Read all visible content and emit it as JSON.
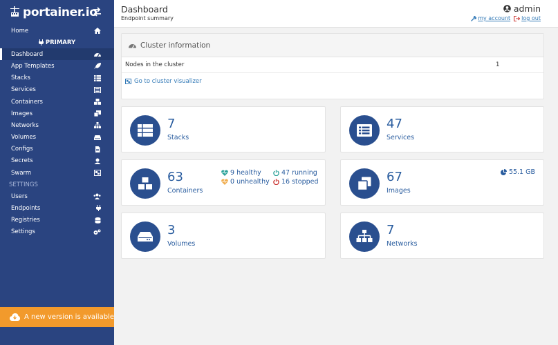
{
  "brand": {
    "name": "portainer.io"
  },
  "sidebar": {
    "home": "Home",
    "endpoint": "PRIMARY",
    "items": [
      {
        "label": "Dashboard",
        "icon": "tachometer-icon",
        "active": true
      },
      {
        "label": "App Templates",
        "icon": "rocket-icon"
      },
      {
        "label": "Stacks",
        "icon": "th-list-icon"
      },
      {
        "label": "Services",
        "icon": "list-alt-icon"
      },
      {
        "label": "Containers",
        "icon": "server-icon"
      },
      {
        "label": "Images",
        "icon": "clone-icon"
      },
      {
        "label": "Networks",
        "icon": "sitemap-icon"
      },
      {
        "label": "Volumes",
        "icon": "hdd-icon"
      },
      {
        "label": "Configs",
        "icon": "file-code-icon"
      },
      {
        "label": "Secrets",
        "icon": "user-secret-icon"
      },
      {
        "label": "Swarm",
        "icon": "object-group-icon"
      }
    ],
    "settings_label": "SETTINGS",
    "settings_items": [
      {
        "label": "Users",
        "icon": "users-icon"
      },
      {
        "label": "Endpoints",
        "icon": "plug-icon"
      },
      {
        "label": "Registries",
        "icon": "database-icon"
      },
      {
        "label": "Settings",
        "icon": "cogs-icon"
      }
    ],
    "update_banner": "A new version is available"
  },
  "header": {
    "title": "Dashboard",
    "subtitle": "Endpoint summary",
    "username": "admin",
    "my_account": "my account",
    "log_out": "log out"
  },
  "cluster": {
    "title": "Cluster information",
    "nodes_label": "Nodes in the cluster",
    "nodes_value": "1",
    "visualizer_link": "Go to cluster visualizer"
  },
  "tiles": {
    "stacks": {
      "value": "7",
      "label": "Stacks"
    },
    "services": {
      "value": "47",
      "label": "Services"
    },
    "containers": {
      "value": "63",
      "label": "Containers",
      "healthy": "9 healthy",
      "unhealthy": "0 unhealthy",
      "running": "47 running",
      "stopped": "16 stopped"
    },
    "images": {
      "value": "67",
      "label": "Images",
      "size": "55.1 GB"
    },
    "volumes": {
      "value": "3",
      "label": "Volumes"
    },
    "networks": {
      "value": "7",
      "label": "Networks"
    }
  },
  "colors": {
    "sidebar": "#2a4480",
    "accent": "#2a5d9f",
    "tile_icon": "#2a4f8f",
    "banner": "#f29a2c",
    "healthy": "#2aa198",
    "unhealthy": "#f0ad4e",
    "running": "#2aa198",
    "stopped": "#c9302c"
  }
}
